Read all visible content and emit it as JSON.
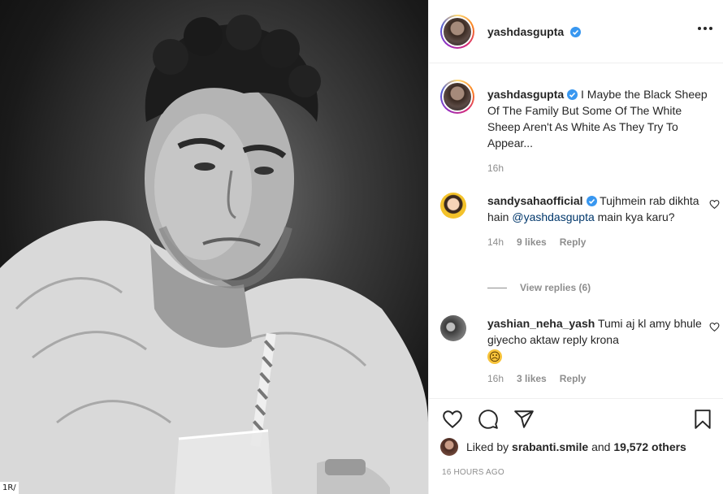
{
  "post": {
    "photo_tag": "1R/"
  },
  "header": {
    "username": "yashdasgupta",
    "more_icon": "more-horizontal-icon"
  },
  "caption": {
    "username": "yashdasgupta",
    "text": "I Maybe the Black Sheep Of The Family But Some Of The White Sheep Aren't As White As They Try To Appear...",
    "time": "16h"
  },
  "comments": [
    {
      "username": "sandysahaofficial",
      "verified": true,
      "text_before": "Tujhmein rab dikhta hain",
      "mention": "@yashdasgupta",
      "text_after": "main kya karu?",
      "time": "14h",
      "likes": "9 likes",
      "reply": "Reply",
      "view_replies": "View replies (6)"
    },
    {
      "username": "yashian_neha_yash",
      "verified": false,
      "text": "Tumi aj kl amy bhule giyecho aktaw reply krona",
      "emoji": "☹",
      "time": "16h",
      "likes": "3 likes",
      "reply": "Reply"
    }
  ],
  "actions": {
    "icons": [
      "heart-icon",
      "comment-icon",
      "share-icon",
      "bookmark-icon"
    ],
    "liked_prefix": "Liked by",
    "liked_user": "srabanti.smile",
    "liked_and": "and",
    "liked_count": "19,572 others",
    "time_ago": "16 HOURS AGO"
  },
  "colors": {
    "verified": "#3897f0",
    "mention": "#00376b",
    "muted": "#8e8e8e",
    "text": "#262626"
  }
}
